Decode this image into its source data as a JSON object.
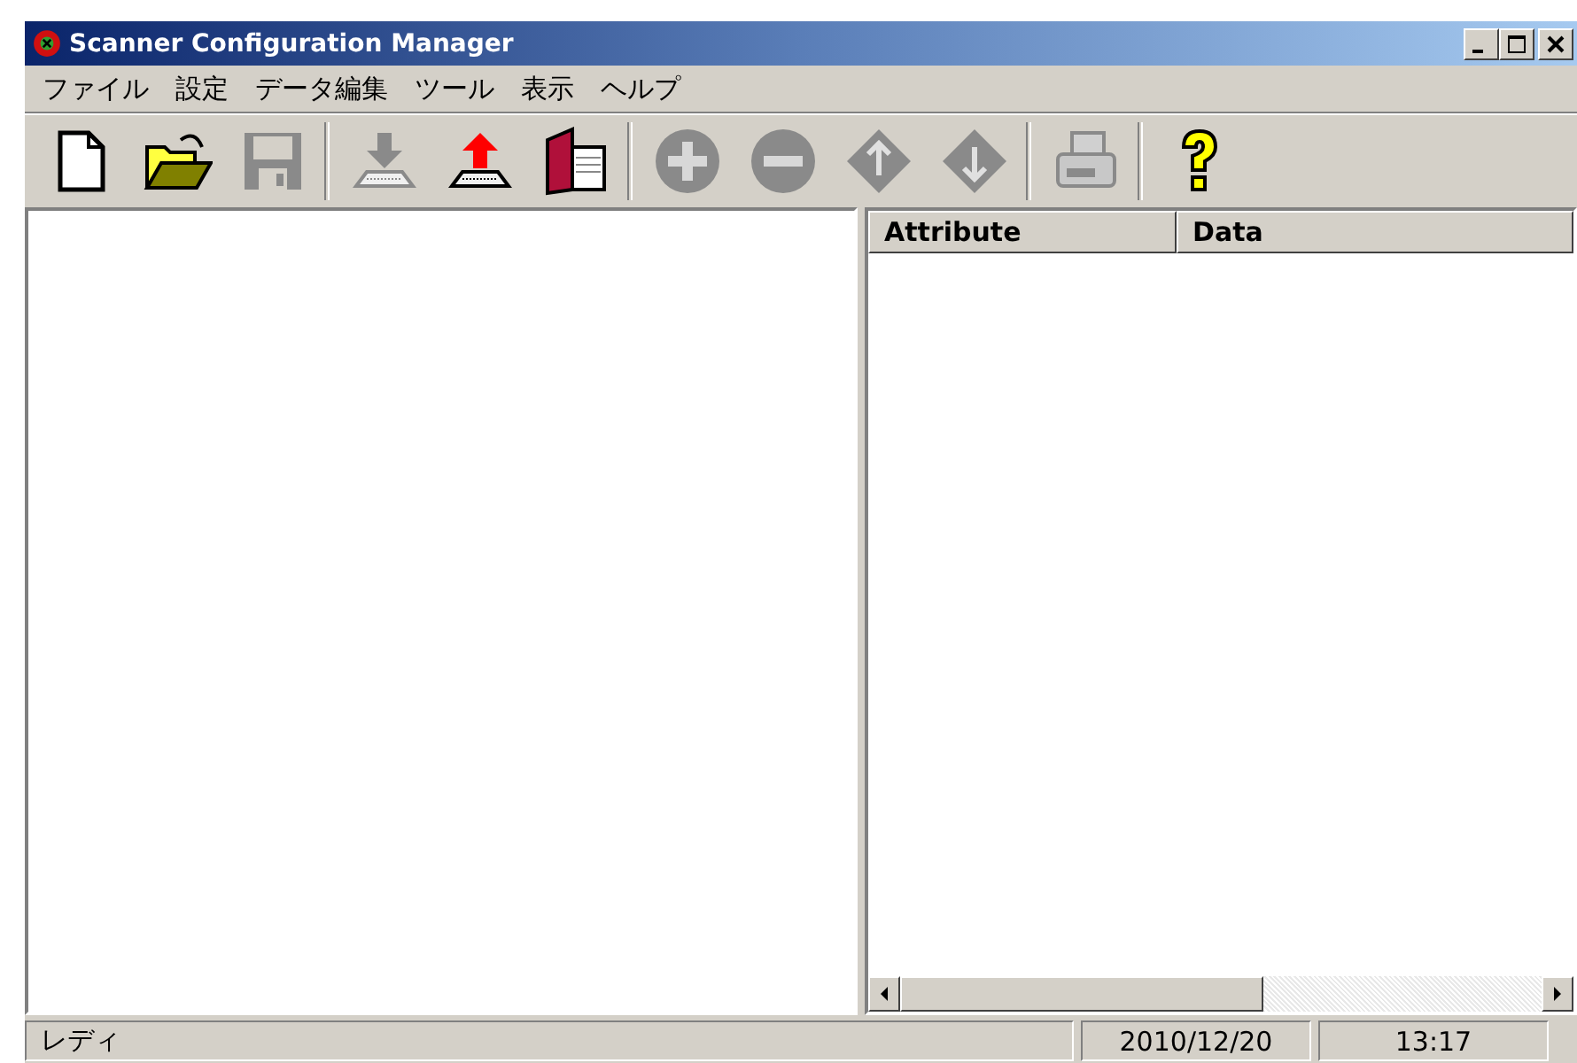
{
  "window": {
    "title": "Scanner Configuration Manager"
  },
  "menu": [
    "ファイル",
    "設定",
    "データ編集",
    "ツール",
    "表示",
    "ヘルプ"
  ],
  "toolbar": [
    {
      "kind": "new",
      "disabled": false
    },
    {
      "kind": "open",
      "disabled": false
    },
    {
      "kind": "save",
      "disabled": true
    },
    {
      "kind": "sep"
    },
    {
      "kind": "download",
      "disabled": true
    },
    {
      "kind": "upload",
      "disabled": false
    },
    {
      "kind": "book",
      "disabled": false
    },
    {
      "kind": "sep"
    },
    {
      "kind": "plus",
      "disabled": true
    },
    {
      "kind": "minus",
      "disabled": true
    },
    {
      "kind": "up",
      "disabled": true
    },
    {
      "kind": "down",
      "disabled": true
    },
    {
      "kind": "sep"
    },
    {
      "kind": "print",
      "disabled": true
    },
    {
      "kind": "sep"
    },
    {
      "kind": "help",
      "disabled": false
    }
  ],
  "table": {
    "columns": [
      "Attribute",
      "Data"
    ]
  },
  "status_bar": {
    "message": "レディ",
    "date": "2010/12/20",
    "time": "13:17"
  }
}
